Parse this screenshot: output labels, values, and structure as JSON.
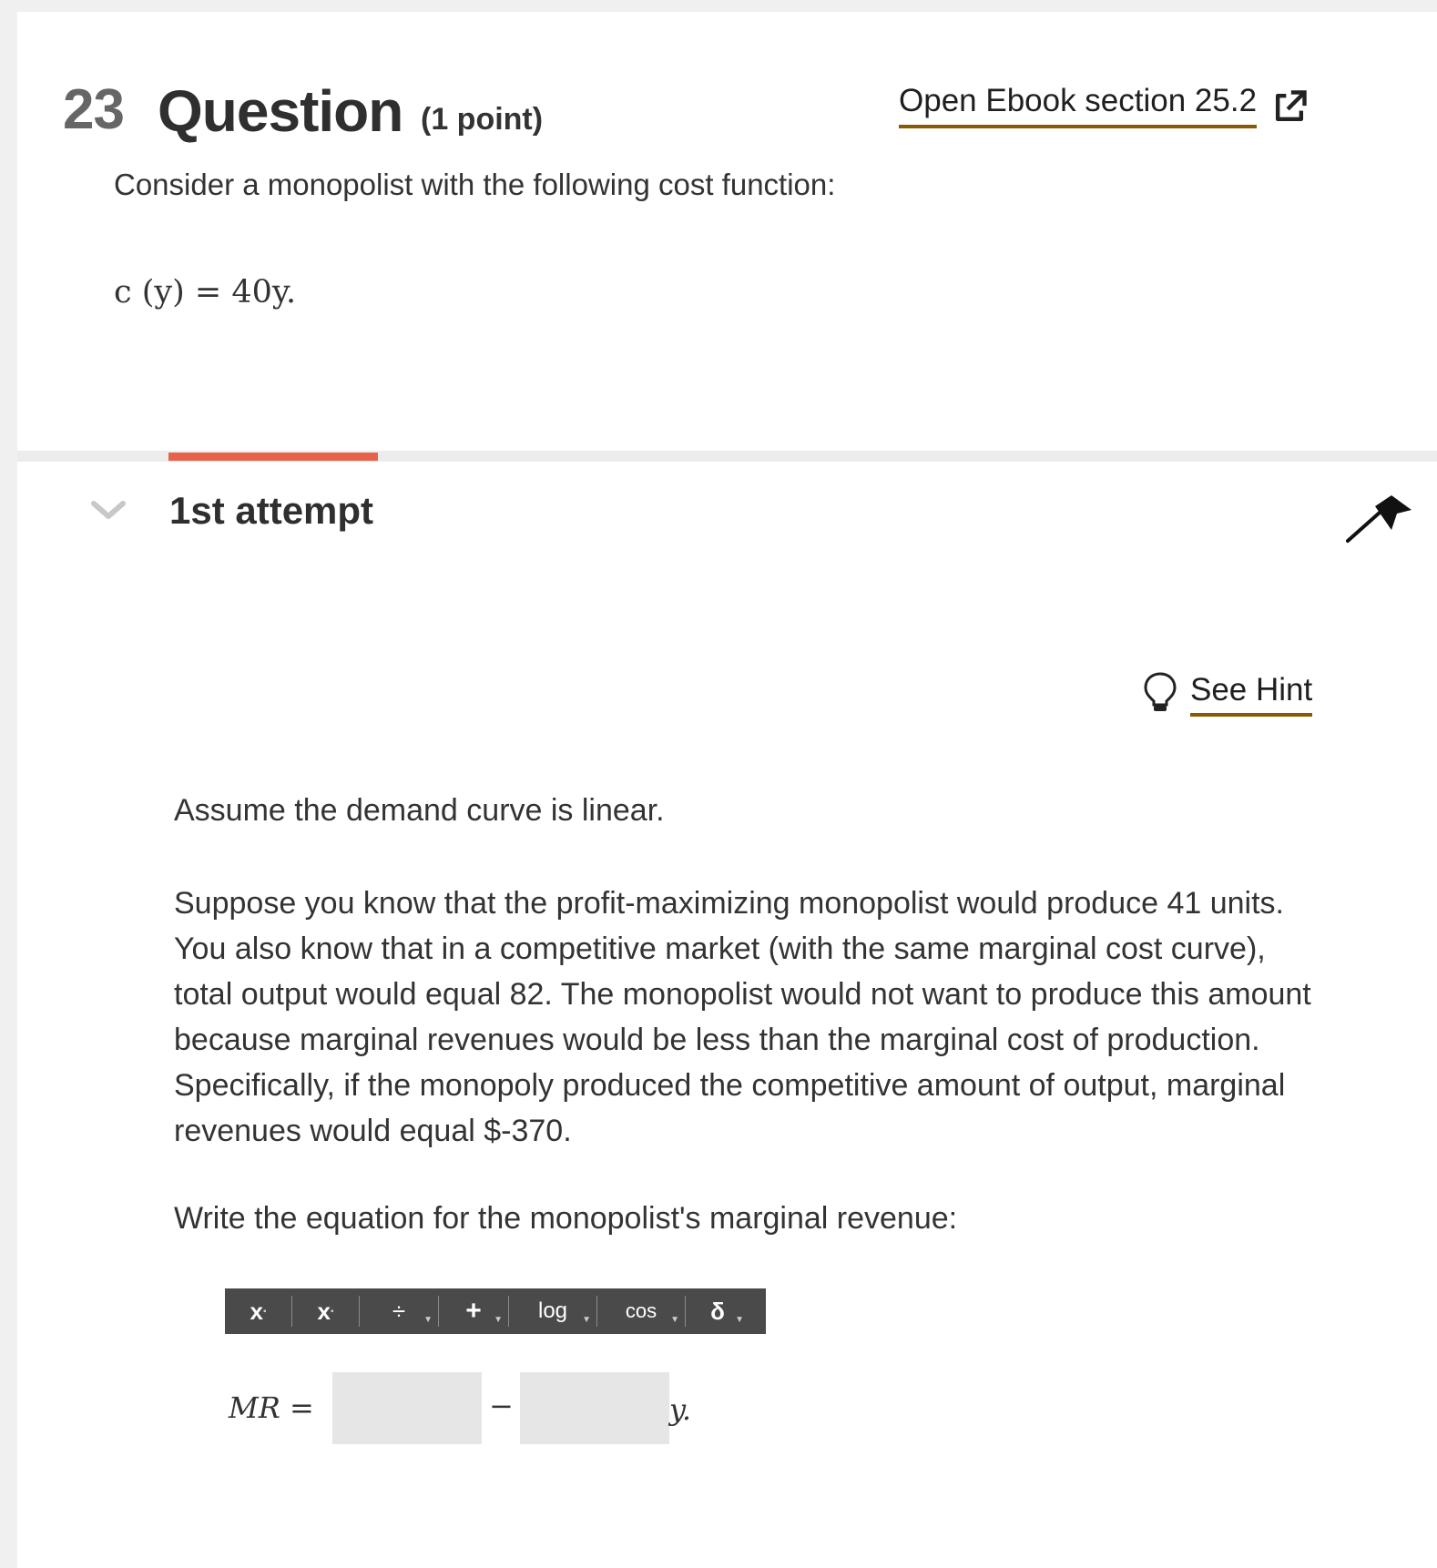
{
  "question": {
    "number": "23",
    "title": "Question",
    "points": "(1 point)",
    "ebook_link": "Open Ebook section 25.2",
    "prompt": "Consider a monopolist with the following cost function:",
    "cost_function": "c (y) = 40y."
  },
  "attempt": {
    "label": "1st attempt",
    "progress_fraction": 0.15,
    "hint_label": "See Hint",
    "assume_text": "Assume the demand curve is linear.",
    "scenario_text": "Suppose you know that the profit-maximizing monopolist would produce 41 units. You also know that in a competitive market (with the same marginal cost curve), total output would equal 82. The monopolist would not want to produce this amount because marginal revenues would be less than the marginal cost of production. Specifically, if the monopoly produced the competitive amount of output, marginal revenues would equal $-370.",
    "instruction_text": "Write the equation for the monopolist's marginal revenue:",
    "toolbar": {
      "superscript": "x",
      "subscript": "x",
      "fraction": "÷",
      "plus": "+",
      "log": "log",
      "cos": "cos",
      "delta": "δ"
    },
    "equation": {
      "lhs": "MR",
      "equals": "=",
      "minus": "−",
      "tail": "y.",
      "box1_value": "",
      "box2_value": ""
    }
  },
  "colors": {
    "progress": "#e8624a",
    "link_underline": "#8a5a00",
    "toolbar_bg": "#4a4a4a"
  }
}
